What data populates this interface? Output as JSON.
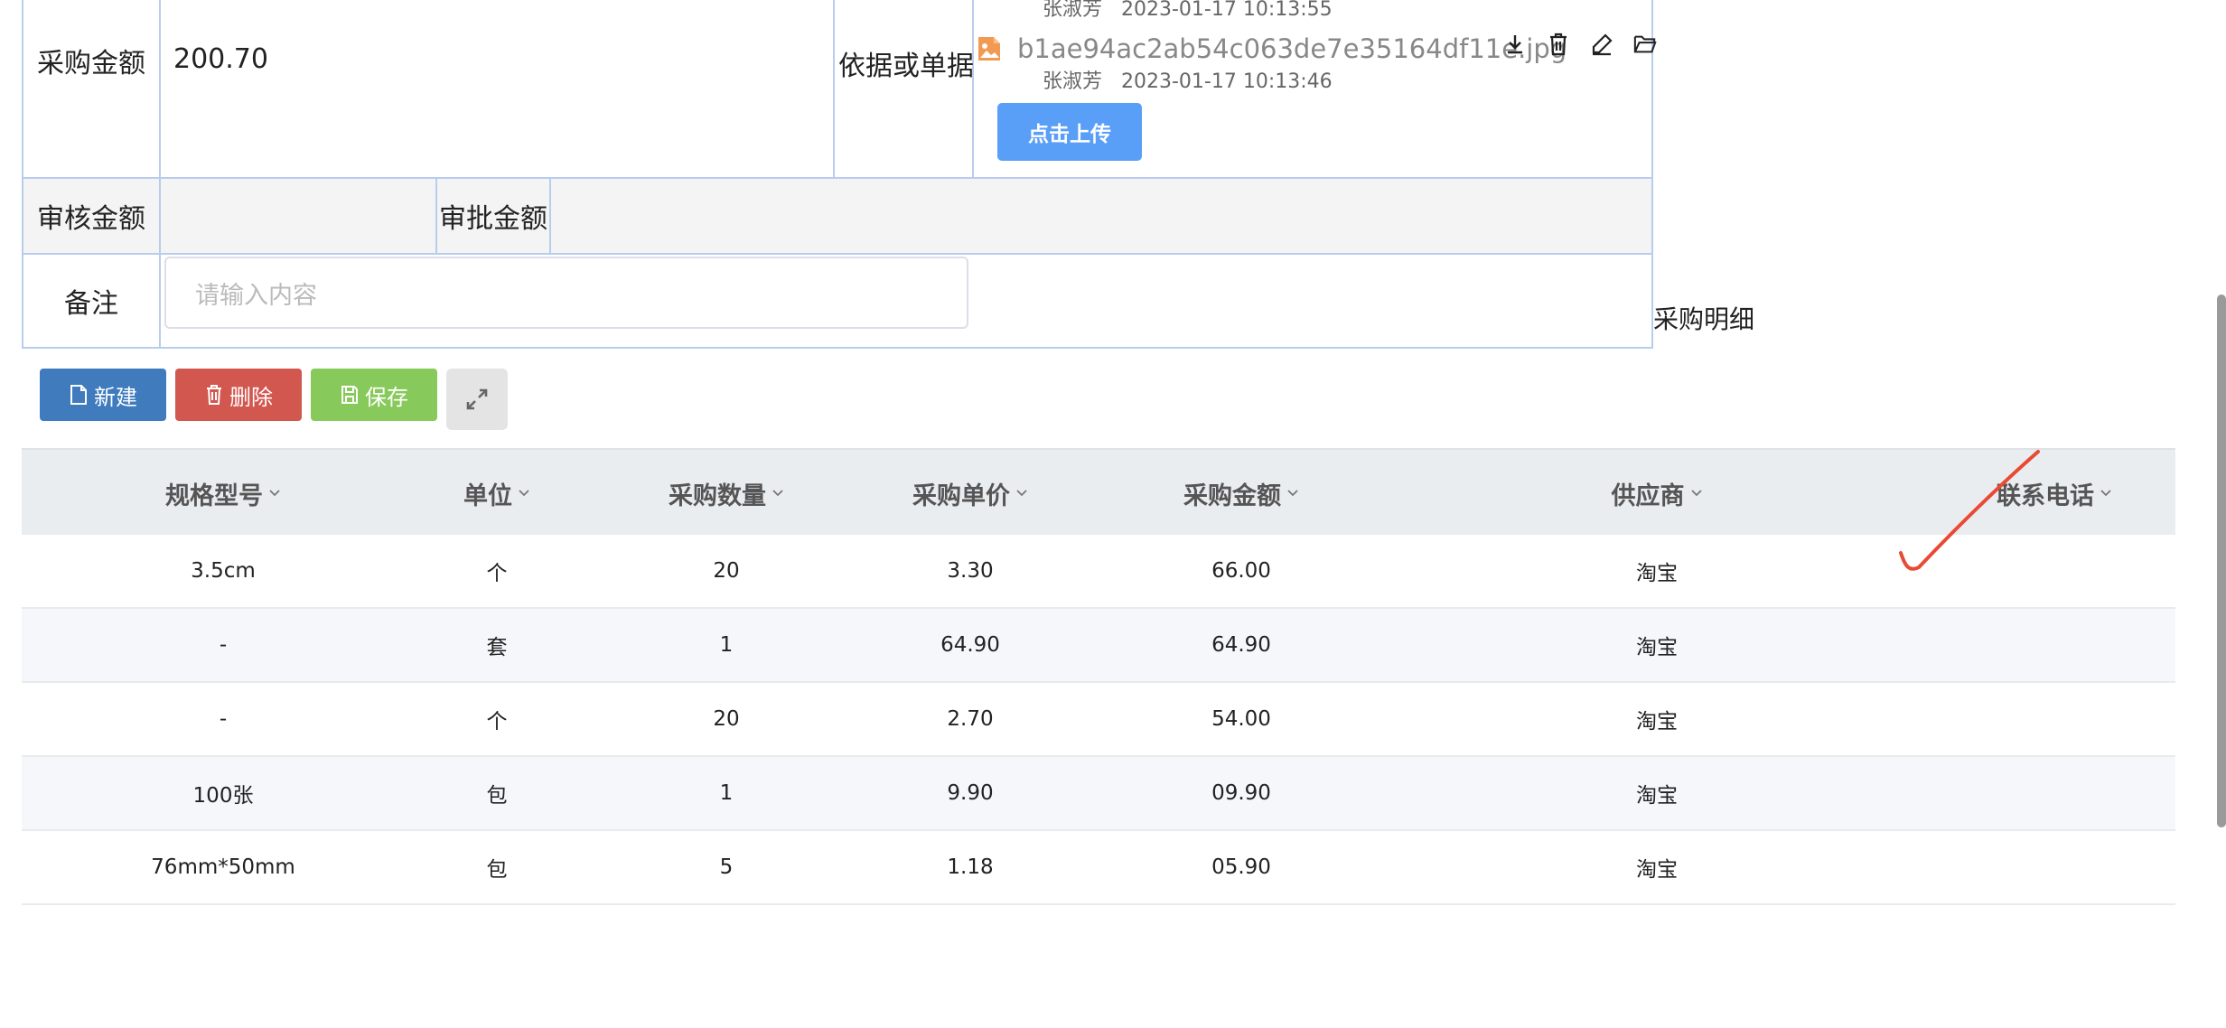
{
  "form": {
    "purchase_amount_label": "采购金额",
    "purchase_amount_value": "200.70",
    "basis_label": "依据或单据",
    "files": {
      "top_meta_user": "张淑芳",
      "top_meta_time": "2023-01-17 10:13:55",
      "file_name": "b1ae94ac2ab54c063de7e35164df11e.jpg",
      "file_meta_user": "张淑芳",
      "file_meta_time": "2023-01-17 10:13:46"
    },
    "upload_label": "点击上传",
    "review_amount_label": "审核金额",
    "approve_amount_label": "审批金额",
    "remark_label": "备注",
    "remark_placeholder": "请输入内容"
  },
  "section_title": "采购明细",
  "toolbar": {
    "new_label": "新建",
    "delete_label": "删除",
    "save_label": "保存"
  },
  "table": {
    "columns": [
      "规格型号",
      "单位",
      "采购数量",
      "采购单价",
      "采购金额",
      "供应商",
      "联系电话"
    ],
    "rows": [
      [
        "3.5cm",
        "个",
        "20",
        "3.30",
        "66.00",
        "淘宝",
        ""
      ],
      [
        "-",
        "套",
        "1",
        "64.90",
        "64.90",
        "淘宝",
        ""
      ],
      [
        "-",
        "个",
        "20",
        "2.70",
        "54.00",
        "淘宝",
        ""
      ],
      [
        "100张",
        "包",
        "1",
        "9.90",
        "09.90",
        "淘宝",
        ""
      ],
      [
        "76mm*50mm",
        "包",
        "5",
        "1.18",
        "05.90",
        "淘宝",
        ""
      ]
    ]
  },
  "colors": {
    "border": "#b8cdee",
    "primary": "#5a9ff7",
    "new_btn": "#3f7bbd",
    "delete_btn": "#d2574f",
    "save_btn": "#88c95b",
    "file_icon": "#f29a52",
    "annotation": "#e84a34"
  },
  "icons": {
    "file": "image-file-icon",
    "download": "download-icon",
    "delete": "trash-icon",
    "edit": "edit-icon",
    "open": "folder-icon",
    "new": "file-icon",
    "trash": "trash-icon",
    "save": "save-icon",
    "expand": "expand-icon",
    "sort": "chevron-down-icon"
  }
}
